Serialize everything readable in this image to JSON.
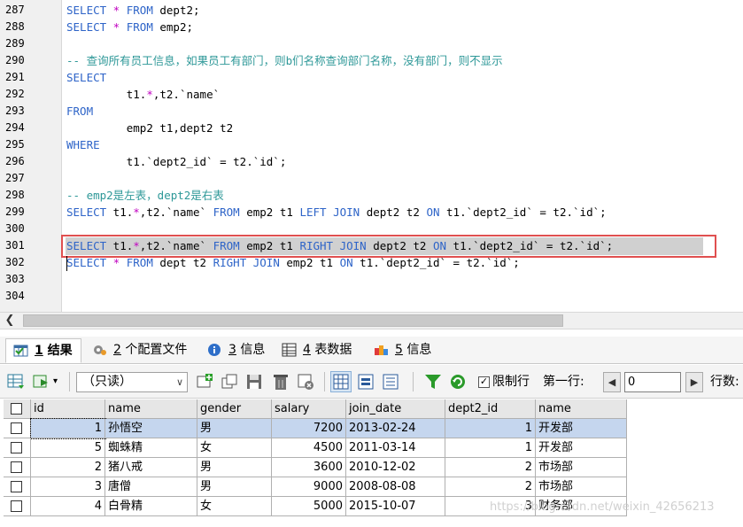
{
  "editor": {
    "lines": [
      {
        "n": "287",
        "parts": [
          [
            "kw",
            "SELECT"
          ],
          [
            "op",
            " *"
          ],
          [
            "",
            "",
            ""
          ],
          [
            "kw",
            " FROM"
          ],
          [
            "",
            " dept2;"
          ]
        ]
      },
      {
        "n": "288",
        "parts": [
          [
            "kw",
            "SELECT"
          ],
          [
            "op",
            " *"
          ],
          [
            "kw",
            " FROM"
          ],
          [
            "",
            " emp2;"
          ]
        ]
      },
      {
        "n": "289",
        "parts": []
      },
      {
        "n": "290",
        "parts": [
          [
            "cm",
            "-- 查询所有员工信息，如果员工有部门，则b们名称查询部门名称，没有部门，则不显示"
          ]
        ]
      },
      {
        "n": "291",
        "parts": [
          [
            "kw",
            "SELECT"
          ]
        ]
      },
      {
        "n": "292",
        "parts": [
          [
            "",
            "\t t1."
          ],
          [
            "op",
            "*"
          ],
          [
            "",
            ",t2.`name`"
          ]
        ]
      },
      {
        "n": "293",
        "parts": [
          [
            "kw",
            "FROM"
          ]
        ]
      },
      {
        "n": "294",
        "parts": [
          [
            "",
            "\t emp2 t1,dept2 t2"
          ]
        ]
      },
      {
        "n": "295",
        "parts": [
          [
            "kw",
            "WHERE"
          ]
        ]
      },
      {
        "n": "296",
        "parts": [
          [
            "",
            "\t t1.`dept2_id` = t2.`id`;"
          ]
        ]
      },
      {
        "n": "297",
        "parts": []
      },
      {
        "n": "298",
        "parts": [
          [
            "cm",
            "-- emp2是左表，dept2是右表"
          ]
        ]
      },
      {
        "n": "299",
        "parts": [
          [
            "kw",
            "SELECT"
          ],
          [
            "",
            " t1."
          ],
          [
            "op",
            "*"
          ],
          [
            "",
            ",t2.`name` "
          ],
          [
            "kw",
            "FROM"
          ],
          [
            "",
            " emp2 t1 "
          ],
          [
            "kw",
            "LEFT JOIN"
          ],
          [
            "",
            " dept2 t2 "
          ],
          [
            "kw",
            "ON"
          ],
          [
            "",
            " t1.`dept2_id` = t2.`id`;"
          ]
        ]
      },
      {
        "n": "300",
        "parts": []
      },
      {
        "n": "301",
        "parts": [
          [
            "kw",
            "SELECT"
          ],
          [
            "",
            " t1."
          ],
          [
            "op",
            "*"
          ],
          [
            "",
            ",t2.`name` "
          ],
          [
            "kw",
            "FROM"
          ],
          [
            "",
            " emp2 t1 "
          ],
          [
            "kw",
            "RIGHT JOIN"
          ],
          [
            "",
            " dept2 t2 "
          ],
          [
            "kw",
            "ON"
          ],
          [
            "",
            " t1.`dept2_id` = t2.`id`;"
          ]
        ]
      },
      {
        "n": "302",
        "parts": [
          [
            "kw",
            "SELECT"
          ],
          [
            "op",
            " *"
          ],
          [
            "kw",
            " FROM"
          ],
          [
            "",
            " dept t2 "
          ],
          [
            "kw",
            "RIGHT JOIN"
          ],
          [
            "",
            " emp2 t1 "
          ],
          [
            "kw",
            "ON"
          ],
          [
            "",
            " t1.`dept2_id` = t2.`id`;"
          ]
        ]
      },
      {
        "n": "303",
        "parts": []
      },
      {
        "n": "304",
        "parts": []
      }
    ]
  },
  "tabs": [
    {
      "num": "1",
      "label": "结果",
      "icon": "result-grid-icon"
    },
    {
      "num": "2",
      "label": "个配置文件",
      "icon": "profile-icon"
    },
    {
      "num": "3",
      "label": "信息",
      "icon": "info-icon"
    },
    {
      "num": "4",
      "label": "表数据",
      "icon": "table-data-icon"
    },
    {
      "num": "5",
      "label": "信息",
      "icon": "info-multi-icon"
    }
  ],
  "toolbar": {
    "mode": "（只读）",
    "limit_label": "限制行",
    "first_row_label": "第一行:",
    "first_row_value": "0",
    "rows_label": "行数:"
  },
  "grid": {
    "columns": [
      "id",
      "name",
      "gender",
      "salary",
      "join_date",
      "dept2_id",
      "name"
    ],
    "rows": [
      [
        "1",
        "孙悟空",
        "男",
        "7200",
        "2013-02-24",
        "1",
        "开发部"
      ],
      [
        "5",
        "蜘蛛精",
        "女",
        "4500",
        "2011-03-14",
        "1",
        "开发部"
      ],
      [
        "2",
        "猪八戒",
        "男",
        "3600",
        "2010-12-02",
        "2",
        "市场部"
      ],
      [
        "3",
        "唐僧",
        "男",
        "9000",
        "2008-08-08",
        "2",
        "市场部"
      ],
      [
        "4",
        "白骨精",
        "女",
        "5000",
        "2015-10-07",
        "3",
        "财务部"
      ]
    ]
  },
  "watermark": "https://blog.csdn.net/weixin_42656213",
  "colors": {
    "keyword": "#2e64c8",
    "comment": "#2e9898",
    "operator": "#c000c0",
    "highlight_box": "#e05050"
  }
}
